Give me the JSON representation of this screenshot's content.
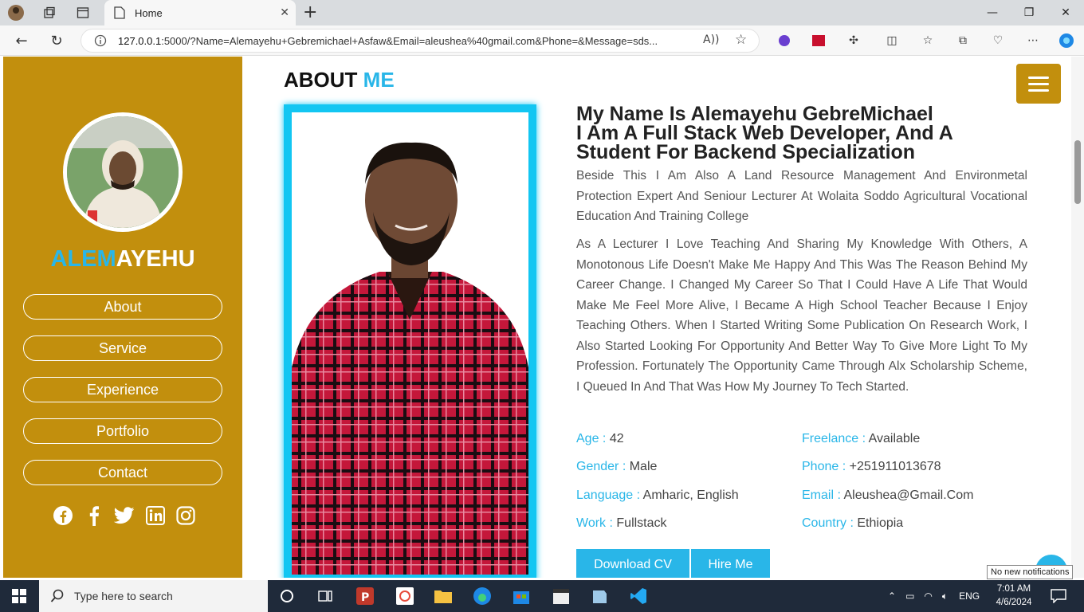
{
  "browser": {
    "tab_title": "Home",
    "url_host": "127.0.0.1",
    "url_rest": ":5000/?Name=Alemayehu+Gebremichael+Asfaw&Email=aleushea%40gmail.com&Phone=&Message=sds..."
  },
  "sidebar": {
    "brand_highlight": "ALEM",
    "brand_rest": "AYEHU",
    "nav": [
      "About",
      "Service",
      "Experience",
      "Portfolio",
      "Contact"
    ],
    "socials": [
      "facebook-icon",
      "facebook-f-icon",
      "twitter-icon",
      "linkedin-icon",
      "instagram-icon"
    ]
  },
  "about": {
    "title_a": "ABOUT",
    "title_b": "ME",
    "heading_line1": "My Name Is Alemayehu GebreMichael",
    "heading_line2": "I Am A Full Stack Web Developer, And A",
    "heading_line3": "Student For Backend Specialization",
    "para1": "Beside This I Am Also A Land Resource Management And Environmetal Protection Expert And Seniour Lecturer At Wolaita Soddo Agricultural Vocational Education And Training College",
    "para2": "As A Lecturer I Love Teaching And Sharing My Knowledge With Others, A Monotonous Life Doesn't Make Me Happy And This Was The Reason Behind My Career Change. I Changed My Career So That I Could Have A Life That Would Make Me Feel More Alive, I Became A High School Teacher Because I Enjoy Teaching Others. When I Started Writing Some Publication On Research Work, I Also Started Looking For Opportunity And Better Way To Give More Light To My Profession. Fortunately The Opportunity Came Through Alx Scholarship Scheme, I Queued In And That Was How My Journey To Tech Started.",
    "info": [
      {
        "key": "Age :",
        "value": "42"
      },
      {
        "key": "Freelance :",
        "value": "Available"
      },
      {
        "key": "Gender :",
        "value": "Male"
      },
      {
        "key": "Phone :",
        "value": "+251911013678"
      },
      {
        "key": "Language :",
        "value": "Amharic, English"
      },
      {
        "key": "Email :",
        "value": "Aleushea@Gmail.Com"
      },
      {
        "key": "Work :",
        "value": "Fullstack"
      },
      {
        "key": "Country :",
        "value": "Ethiopia"
      }
    ],
    "download_cv": "Download CV",
    "hire_me": "Hire Me"
  },
  "taskbar": {
    "search_placeholder": "Type here to search",
    "lang": "ENG",
    "time": "7:01 AM",
    "date": "4/6/2024",
    "notification_tip": "No new notifications"
  },
  "colors": {
    "sidebar": "#c28f0d",
    "accent": "#29b6e8",
    "frame": "#12c6f2"
  }
}
